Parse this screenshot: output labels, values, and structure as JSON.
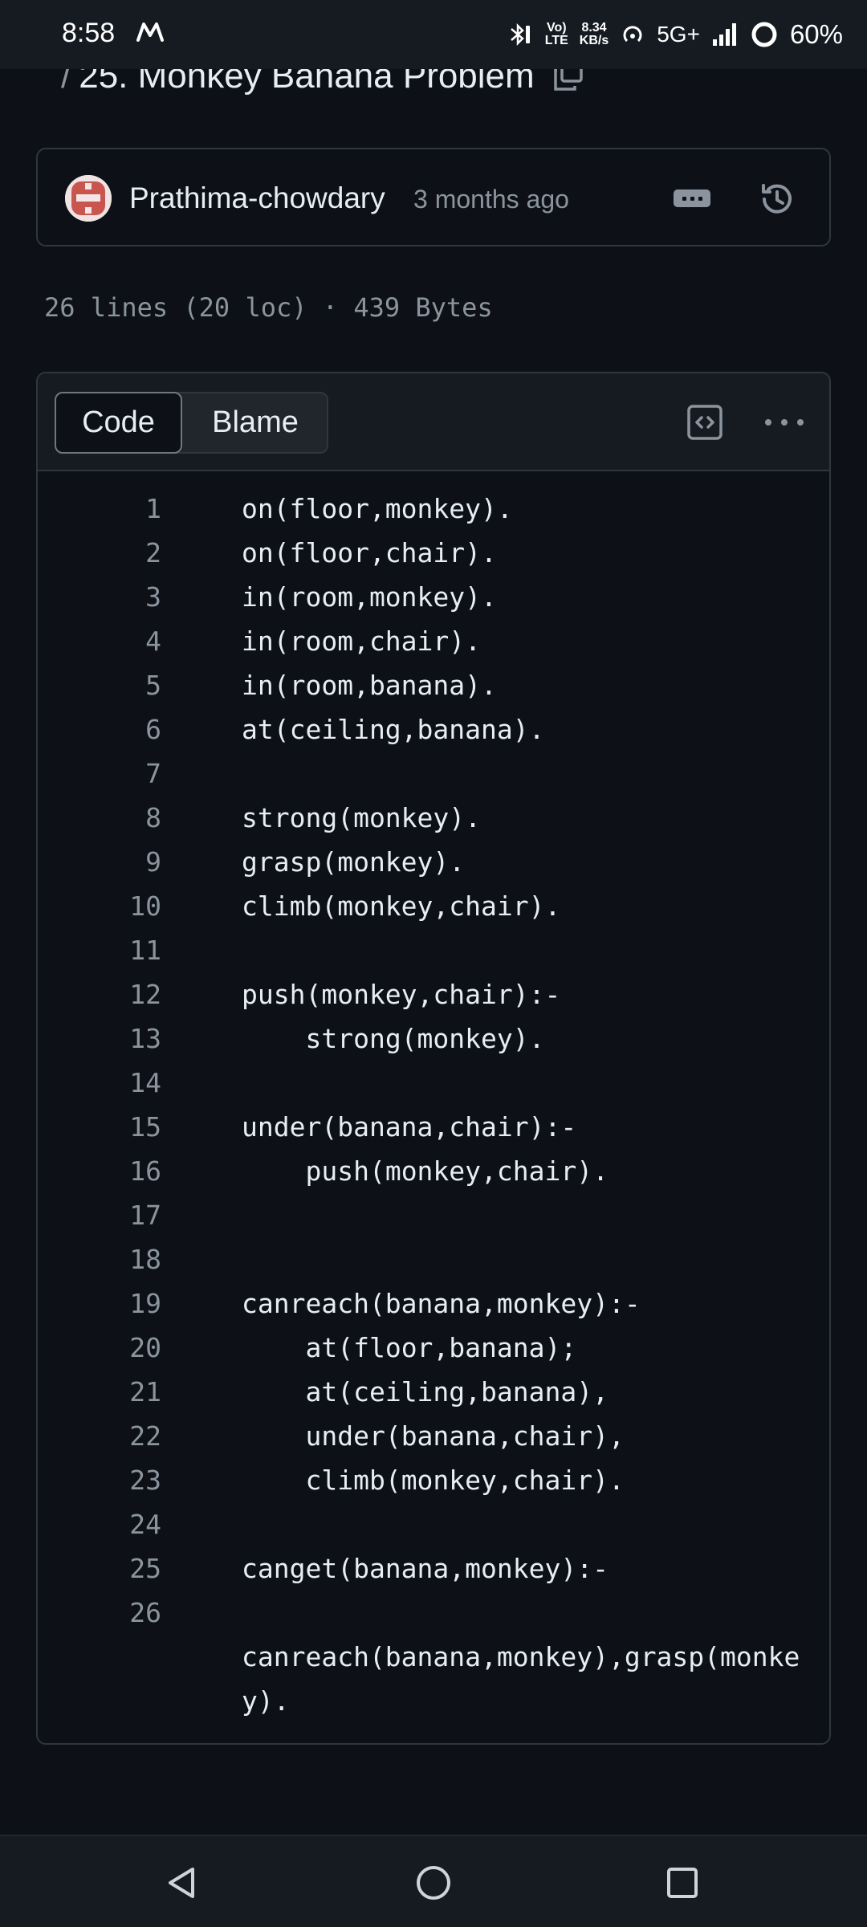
{
  "status_bar": {
    "time": "8:58",
    "app_icon": "m-logo-icon",
    "volte_top": "Vo)",
    "volte_bottom": "LTE",
    "speed_top": "8.34",
    "speed_bottom": "KB/s",
    "network": "5G+",
    "battery": "60%"
  },
  "header": {
    "slash": "/",
    "title": "25. Monkey Banana Problem"
  },
  "commit": {
    "author": "Prathima-chowdary",
    "time_ago": "3 months ago"
  },
  "file_info": "26 lines (20 loc) · 439 Bytes",
  "code_view": {
    "tabs": {
      "code": "Code",
      "blame": "Blame"
    },
    "lines": [
      {
        "n": "1",
        "text": "on(floor,monkey)."
      },
      {
        "n": "2",
        "text": "on(floor,chair)."
      },
      {
        "n": "3",
        "text": "in(room,monkey)."
      },
      {
        "n": "4",
        "text": "in(room,chair)."
      },
      {
        "n": "5",
        "text": "in(room,banana)."
      },
      {
        "n": "6",
        "text": "at(ceiling,banana)."
      },
      {
        "n": "7",
        "text": ""
      },
      {
        "n": "8",
        "text": "strong(monkey)."
      },
      {
        "n": "9",
        "text": "grasp(monkey)."
      },
      {
        "n": "10",
        "text": "climb(monkey,chair)."
      },
      {
        "n": "11",
        "text": ""
      },
      {
        "n": "12",
        "text": "push(monkey,chair):-"
      },
      {
        "n": "13",
        "text": "    strong(monkey)."
      },
      {
        "n": "14",
        "text": ""
      },
      {
        "n": "15",
        "text": "under(banana,chair):-"
      },
      {
        "n": "16",
        "text": "    push(monkey,chair)."
      },
      {
        "n": "17",
        "text": ""
      },
      {
        "n": "18",
        "text": ""
      },
      {
        "n": "19",
        "text": "canreach(banana,monkey):-"
      },
      {
        "n": "20",
        "text": "    at(floor,banana);"
      },
      {
        "n": "21",
        "text": "    at(ceiling,banana),"
      },
      {
        "n": "22",
        "text": "    under(banana,chair),"
      },
      {
        "n": "23",
        "text": "    climb(monkey,chair)."
      },
      {
        "n": "24",
        "text": ""
      },
      {
        "n": "25",
        "text": "canget(banana,monkey):-"
      },
      {
        "n": "26",
        "text": ""
      },
      {
        "n": "",
        "text": "canreach(banana,monkey),grasp(monke"
      },
      {
        "n": "",
        "text": "y)."
      }
    ]
  },
  "colors": {
    "background": "#0d1117",
    "surface": "#161b22",
    "border": "#30363d",
    "text": "#e6edf3",
    "muted": "#8b949e"
  }
}
